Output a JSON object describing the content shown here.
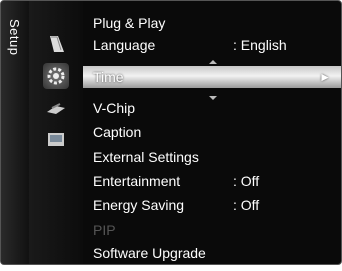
{
  "sidebar": {
    "label": "Setup"
  },
  "icons": [
    "picture-icon",
    "setup-gear-icon",
    "input-icon",
    "application-icon"
  ],
  "menu": {
    "items": [
      {
        "label": "Plug & Play",
        "value": ""
      },
      {
        "label": "Language",
        "value": ": English"
      },
      {
        "label": "Time",
        "value": "",
        "selected": true
      },
      {
        "label": "V-Chip",
        "value": ""
      },
      {
        "label": "Caption",
        "value": ""
      },
      {
        "label": "External Settings",
        "value": ""
      },
      {
        "label": "Entertainment",
        "value": ": Off"
      },
      {
        "label": "Energy Saving",
        "value": ": Off"
      },
      {
        "label": "PIP",
        "value": "",
        "disabled": true
      },
      {
        "label": "Software Upgrade",
        "value": ""
      }
    ],
    "selected_arrow": "►"
  }
}
